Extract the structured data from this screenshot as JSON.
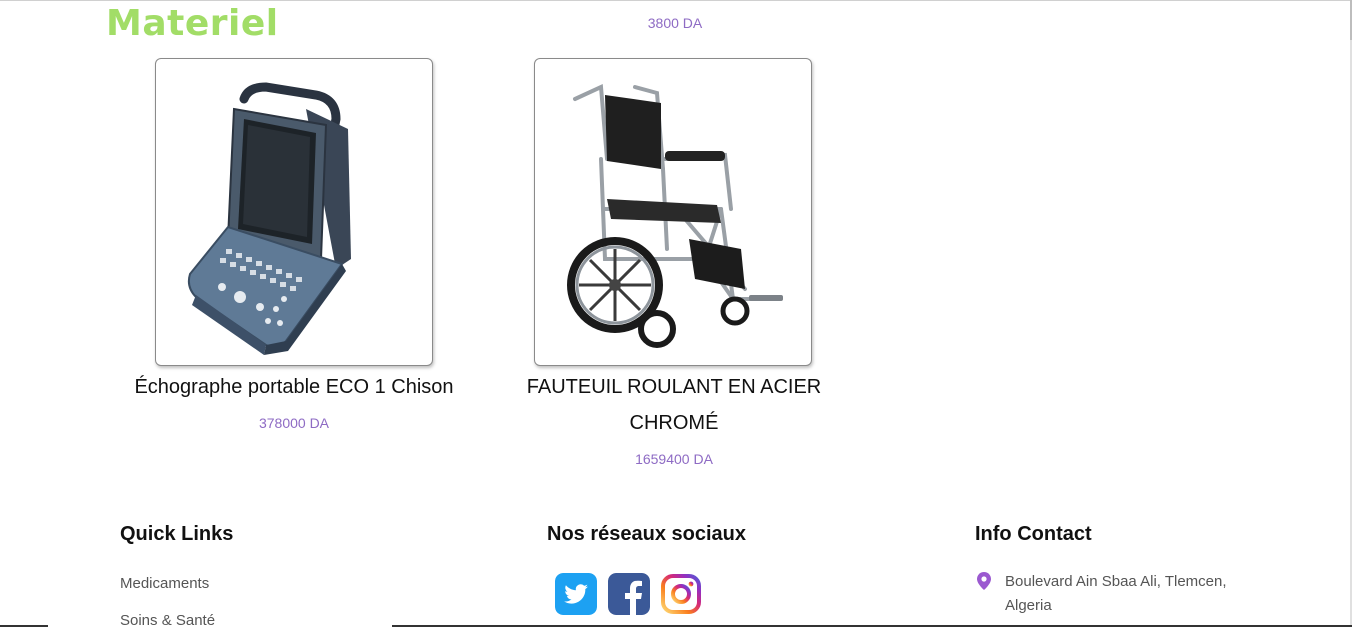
{
  "section": {
    "title": "Materiel"
  },
  "previous_product": {
    "price": "3800 DA"
  },
  "products": [
    {
      "name": "Échographe portable ECO 1 Chison",
      "price": "378000 DA",
      "image_icon": "ultrasound-machine"
    },
    {
      "name": "FAUTEUIL ROULANT EN ACIER CHROMÉ",
      "price": "1659400 DA",
      "image_icon": "wheelchair"
    }
  ],
  "footer": {
    "quick_links": {
      "heading": "Quick Links",
      "items": [
        "Medicaments",
        "Soins & Santé"
      ]
    },
    "social": {
      "heading": "Nos réseaux sociaux",
      "icons": [
        "twitter-icon",
        "facebook-icon",
        "instagram-icon"
      ]
    },
    "contact": {
      "heading": "Info Contact",
      "address": "Boulevard Ain Sbaa Ali, Tlemcen, Algeria",
      "icon": "location-pin-icon"
    }
  },
  "colors": {
    "title_green": "#a2dd67",
    "price_purple": "#8e6bc4",
    "pin_purple": "#9b59d0",
    "twitter_blue": "#1da1f2",
    "facebook_blue": "#3b5998"
  }
}
